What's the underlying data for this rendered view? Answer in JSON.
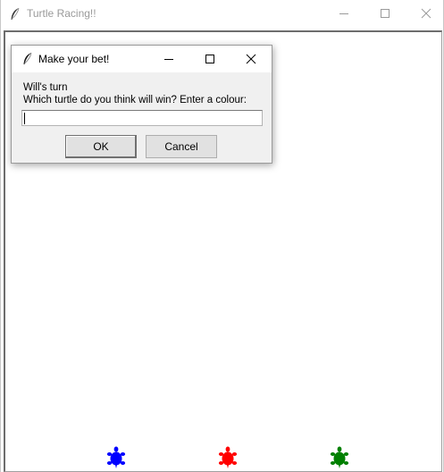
{
  "main_window": {
    "title": "Turtle Racing!!",
    "icon": "feather-icon",
    "controls": [
      "minimize-icon",
      "maximize-icon",
      "close-icon"
    ]
  },
  "turtles": [
    {
      "name": "blue",
      "color": "#0000ff"
    },
    {
      "name": "red",
      "color": "#ff0000"
    },
    {
      "name": "green",
      "color": "#008000"
    }
  ],
  "dialog": {
    "title": "Make your bet!",
    "icon": "feather-icon",
    "prompt_line1": "Will's turn",
    "prompt_line2": "Which turtle do you think will win? Enter a colour:",
    "entry_value": "",
    "ok_label": "OK",
    "cancel_label": "Cancel"
  }
}
